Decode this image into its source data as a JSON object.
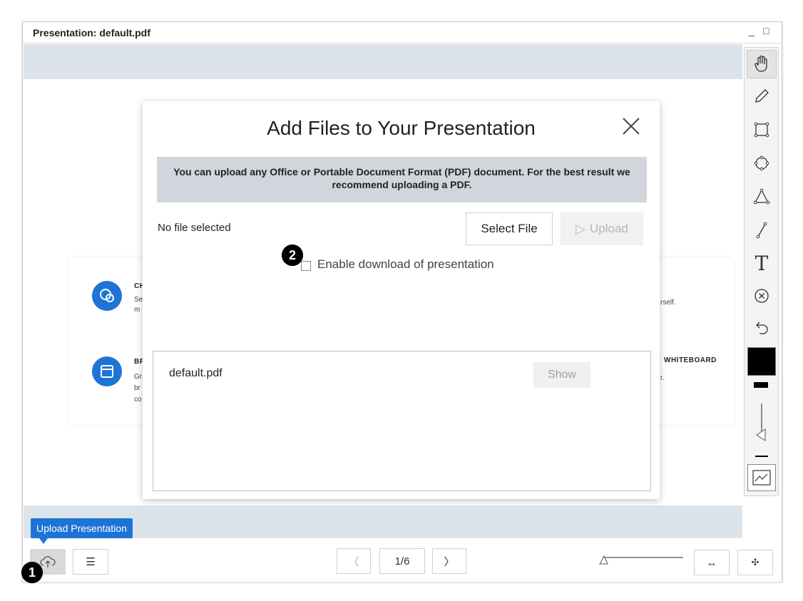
{
  "window": {
    "title": "Presentation: default.pdf",
    "minimize": "_",
    "maximize": "□"
  },
  "slide": {
    "features": [
      {
        "icon": "chat-icon",
        "title": "CH",
        "text_lines": [
          "Se",
          "m"
        ],
        "right_text": "rself."
      },
      {
        "icon": "window-icon",
        "title": "BR",
        "text_lines": [
          "Gr",
          "br",
          "co"
        ],
        "right_title": "WHITEBOARD",
        "right_text": "r."
      }
    ]
  },
  "toolbar": {
    "tools": [
      "hand-icon",
      "pencil-icon",
      "rectangle-icon",
      "ellipse-icon",
      "triangle-icon",
      "line-icon",
      "text-icon",
      "clear-icon",
      "undo-icon",
      "color-swatch",
      "thickness-slider",
      "multi-user-icon"
    ],
    "text_glyph": "T",
    "current_color": "#000000"
  },
  "modal": {
    "title": "Add Files to Your Presentation",
    "close": "✕",
    "info": "You can upload any Office or Portable Document Format (PDF) document.  For the best result we recommend uploading a PDF.",
    "no_file": "No file selected",
    "select_file": "Select File",
    "upload": "Upload",
    "upload_glyph": "▷",
    "enable_download": "Enable download of presentation",
    "files": [
      {
        "name": "default.pdf",
        "action": "Show"
      }
    ]
  },
  "bottombar": {
    "tooltip": "Upload Presentation",
    "page_indicator": "1/6",
    "prev": "〈",
    "next": "〉",
    "fit_width": "↔",
    "fit_page": "✣",
    "list_icon": "☰"
  },
  "markers": {
    "one": "❶",
    "two": "❷"
  },
  "colors": {
    "accent": "#1e74d6",
    "banner": "#d1d6dc",
    "stage": "#dde3eb"
  }
}
